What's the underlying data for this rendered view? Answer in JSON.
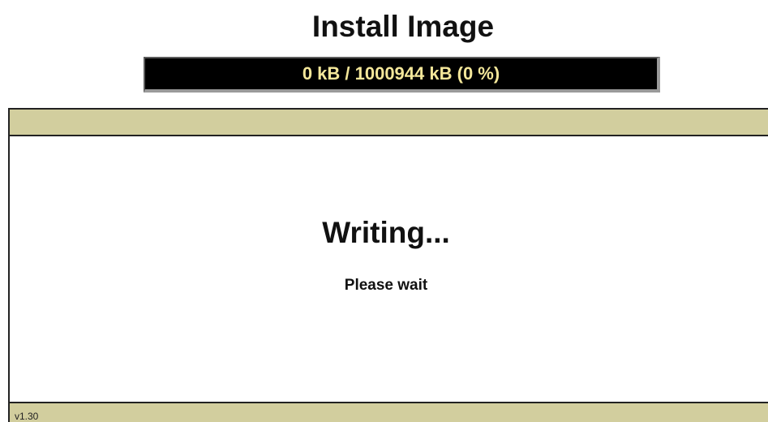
{
  "header": {
    "title": "Install Image"
  },
  "progress": {
    "text": "0 kB / 1000944 kB (0 %)",
    "fraction": 0
  },
  "status": {
    "title": "Writing...",
    "subtitle": "Please wait"
  },
  "footer": {
    "version": "v1.30"
  },
  "colors": {
    "panel_bar": "#d2ce9e",
    "progress_bg": "#000000",
    "progress_text": "#f4e79a"
  }
}
